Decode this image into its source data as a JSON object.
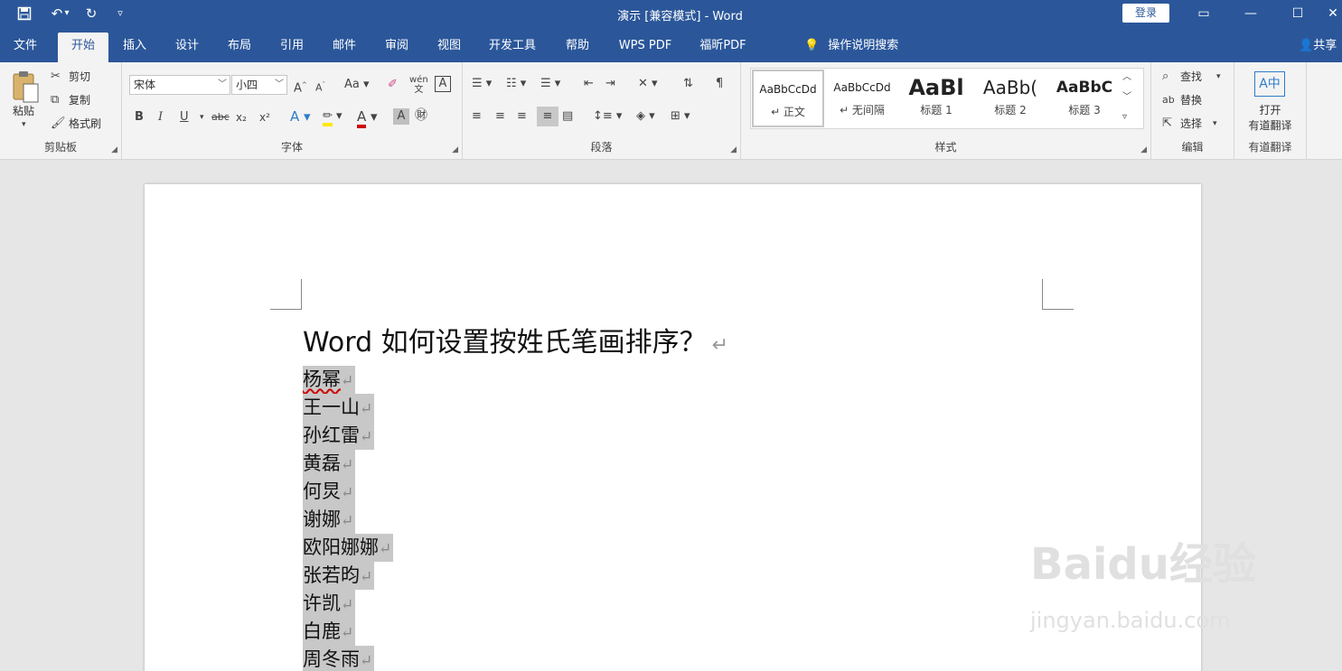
{
  "window": {
    "title": "演示 [兼容模式] - Word",
    "login_label": "登录",
    "colors": {
      "titlebar": "#2b579a",
      "ribbon": "#f3f3f3",
      "page": "#ffffff",
      "selection": "#c8c8c8"
    }
  },
  "quick_access": {
    "save_icon": "save-icon",
    "undo_icon": "undo-icon",
    "redo_icon": "redo-icon",
    "customize_icon": "customize-icon"
  },
  "menu": {
    "tabs": [
      "文件",
      "开始",
      "插入",
      "设计",
      "布局",
      "引用",
      "邮件",
      "审阅",
      "视图",
      "开发工具",
      "帮助",
      "WPS PDF",
      "福昕PDF"
    ],
    "active_tab": "开始",
    "tell_me": "操作说明搜索",
    "share": "共享"
  },
  "ribbon": {
    "clipboard": {
      "paste": "粘贴",
      "cut": "剪切",
      "copy": "复制",
      "format_painter": "格式刷",
      "label": "剪贴板"
    },
    "font": {
      "font_name": "宋体",
      "font_size": "小四",
      "case_label": "Aa",
      "label": "字体",
      "bold": "B",
      "italic": "I",
      "underline": "U",
      "strike": "abc",
      "sub": "x₂",
      "sup": "x²",
      "phonetic": "wén 文",
      "border": "A"
    },
    "paragraph": {
      "label": "段落"
    },
    "styles": {
      "label": "样式",
      "items": [
        {
          "sample": "AaBbCcDd",
          "name": "↵ 正文"
        },
        {
          "sample": "AaBbCcDd",
          "name": "↵ 无间隔"
        },
        {
          "sample": "AaBl",
          "name": "标题 1"
        },
        {
          "sample": "AaBb(",
          "name": "标题 2"
        },
        {
          "sample": "AaBbC",
          "name": "标题 3"
        }
      ]
    },
    "editing": {
      "find": "查找",
      "replace": "替换",
      "select": "选择",
      "label": "编辑"
    },
    "youdao": {
      "open": "打开",
      "translate": "有道翻译",
      "label": "有道翻译"
    }
  },
  "document": {
    "heading": "Word 如何设置按姓氏笔画排序？",
    "paragraph_mark": "↵",
    "names": [
      "杨幂",
      "王一山",
      "孙红雷",
      "黄磊",
      "何炅",
      "谢娜",
      "欧阳娜娜",
      "张若昀",
      "许凯",
      "白鹿",
      "周冬雨"
    ]
  },
  "watermark": {
    "brand": "Baidu经验",
    "url": "jingyan.baidu.com"
  }
}
